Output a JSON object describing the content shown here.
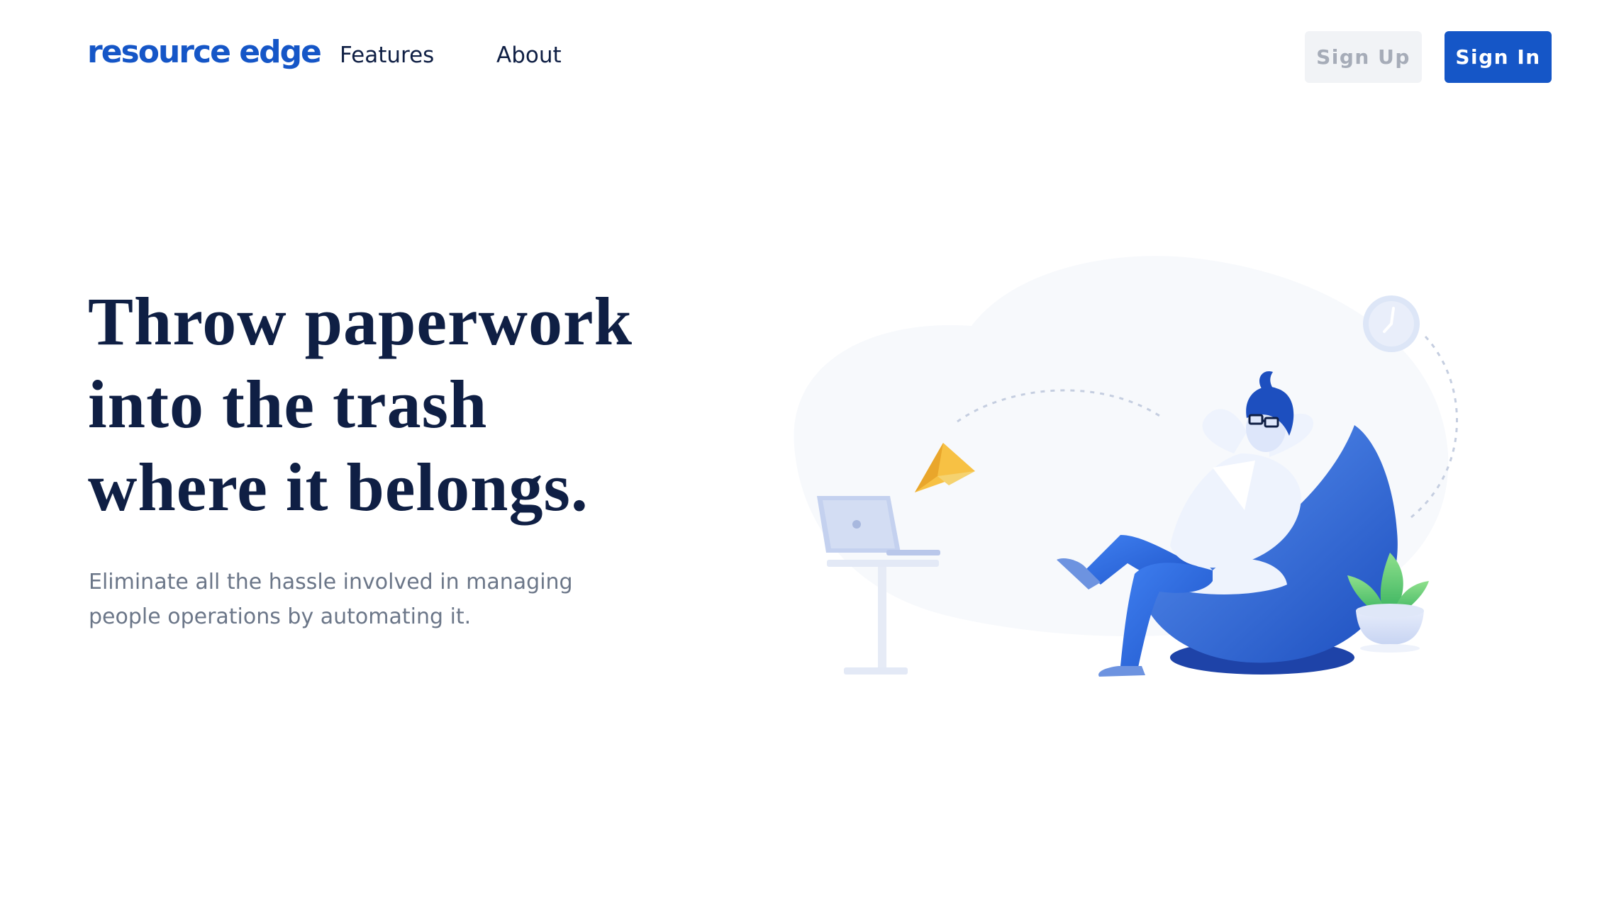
{
  "nav": {
    "logo": "resource edge",
    "links": [
      {
        "label": "Features"
      },
      {
        "label": "About"
      }
    ],
    "signup_label": "Sign Up",
    "signin_label": "Sign In"
  },
  "hero": {
    "headline_lines": [
      "Throw paperwork",
      "into the trash",
      "where it belongs."
    ],
    "subtext_lines": [
      "Eliminate all the hassle involved in managing",
      "people operations by automating it."
    ]
  },
  "illustration": {
    "subject": "person relaxing in bean bag chair with laptop, paper plane, clock and plant",
    "icons": [
      "laptop-icon",
      "paper-plane-icon",
      "clock-icon",
      "plant-icon"
    ]
  },
  "colors": {
    "brand": "#1556c7",
    "heading": "#0f1f44",
    "body_text": "#6b7688",
    "muted_button_bg": "#f1f3f6",
    "muted_button_text": "#a6acb8",
    "accent_yellow": "#f7c144",
    "accent_green": "#4cc46a"
  }
}
